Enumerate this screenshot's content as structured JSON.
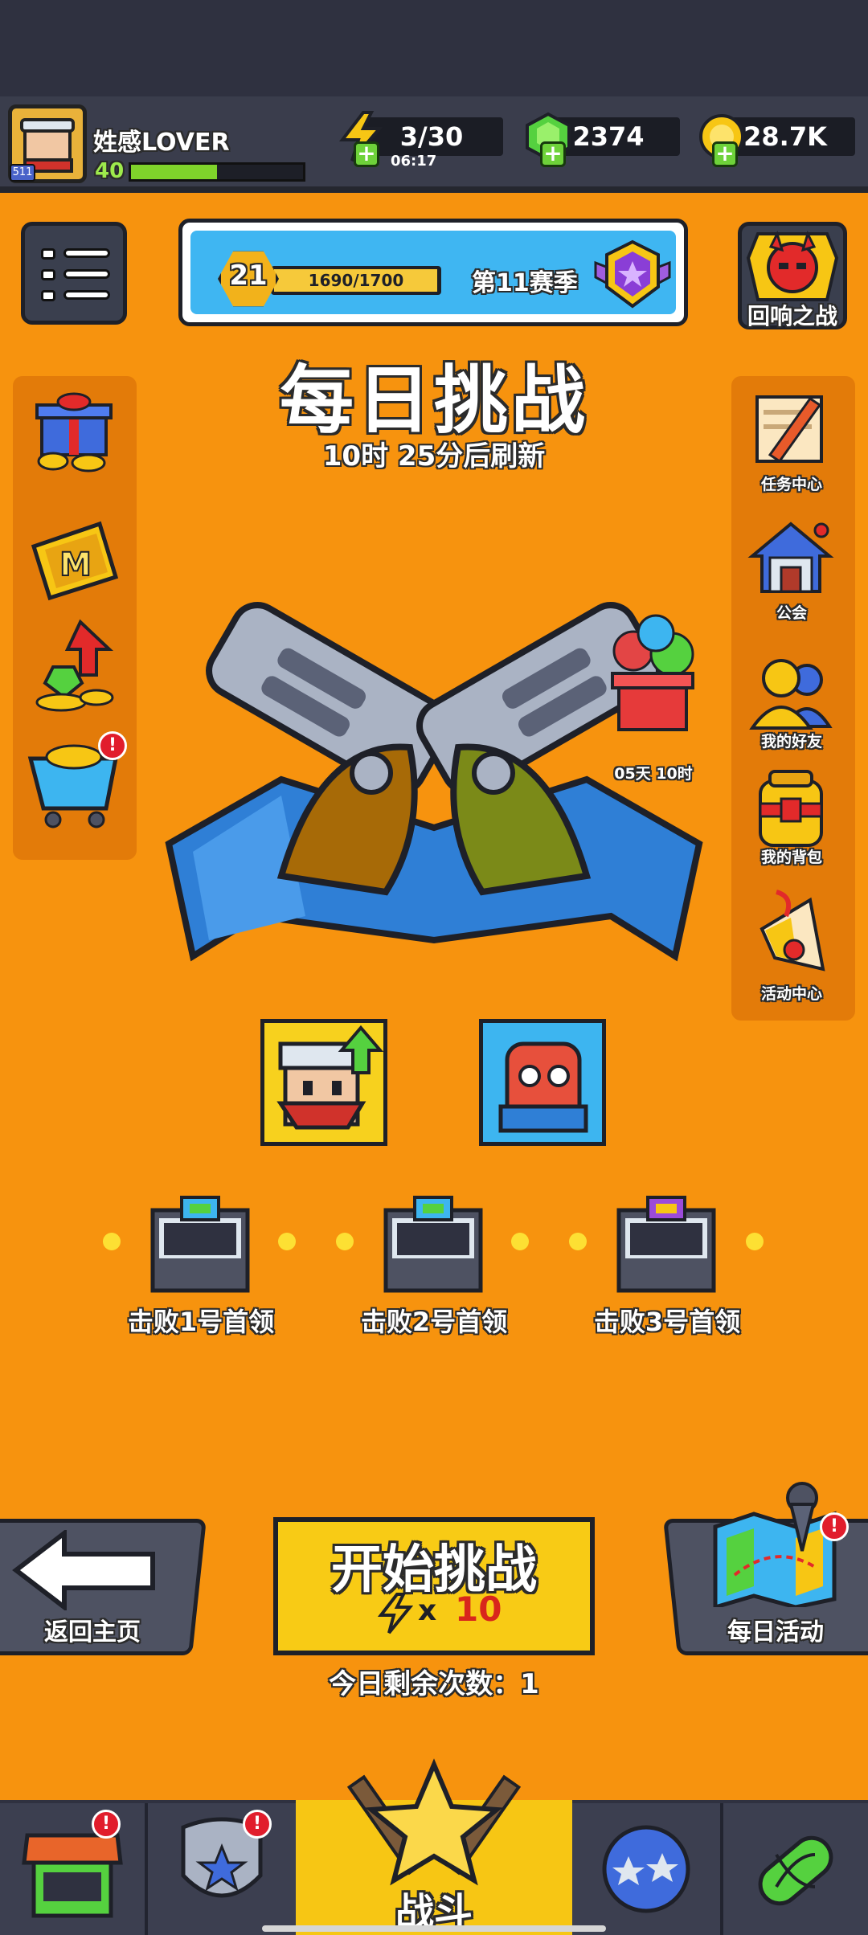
{
  "player": {
    "name": "姓感LOVER",
    "level": "40",
    "avatar_badge": "511",
    "xp_fraction": 0.5
  },
  "resources": {
    "energy": "3/30",
    "energy_timer": "06:17",
    "gems": "2374",
    "coins": "28.7K"
  },
  "season": {
    "level": "21",
    "progress": "1690/1700",
    "progress_fraction": 0.994,
    "label": "第11赛季"
  },
  "echo_battle_label": "回响之战",
  "challenge": {
    "title": "每日挑战",
    "refresh_text": "10时 25分后刷新"
  },
  "right_menu": {
    "tasks": "任务中心",
    "guild": "公会",
    "friends": "我的好友",
    "backpack": "我的背包",
    "events": "活动中心"
  },
  "promo_timer": "05天 10时",
  "bosses": [
    "击败1号首领",
    "击败2号首领",
    "击败3号首领"
  ],
  "actions": {
    "back_label": "返回主页",
    "start_label": "开始挑战",
    "start_cost_x": "x",
    "start_cost": "10",
    "remaining": "今日剩余次数：1",
    "daily_label": "每日活动"
  },
  "alerts": {
    "badge": "!"
  },
  "nav": {
    "battle_label": "战斗"
  },
  "colors": {
    "background": "#f7930e",
    "accent_yellow": "#f8cb15",
    "accent_blue": "#3fb6f2",
    "topbar": "#3a3d4c"
  }
}
